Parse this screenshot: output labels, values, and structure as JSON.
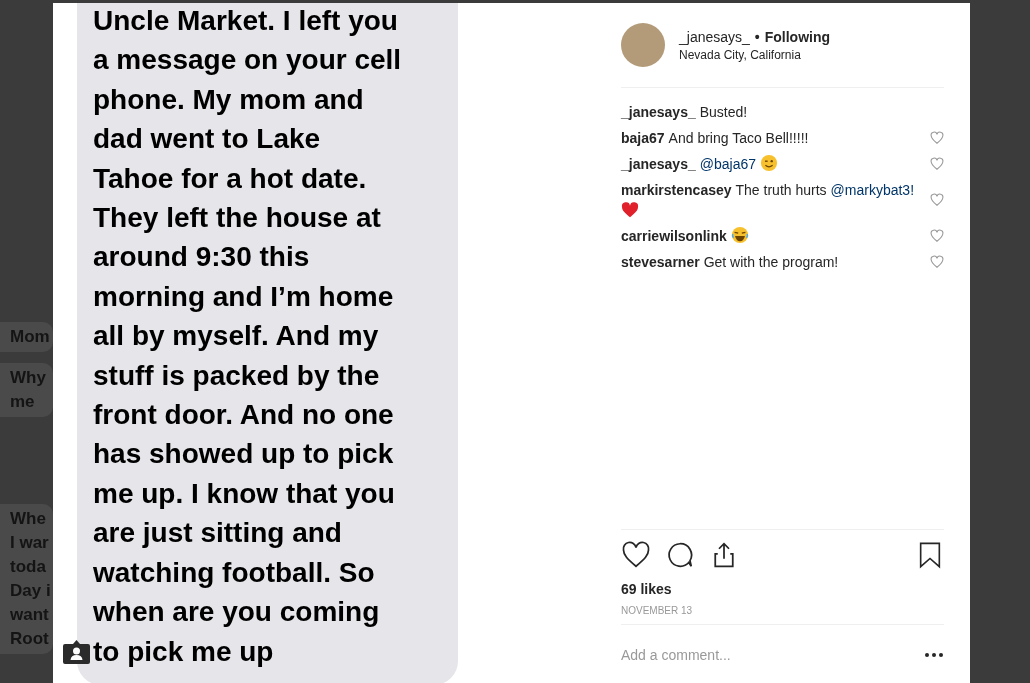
{
  "background_messages": [
    {
      "text": "Mom"
    },
    {
      "text": "Why\nme"
    },
    {
      "text": "Whe\nI war\ntoda\nDay i\nwant\nRoot"
    }
  ],
  "post": {
    "image_message": "Uncle Market. I left you\na message on your cell\nphone. My mom and\ndad went to Lake\nTahoe for a hot date.\nThey left the house at\naround 9:30 this\nmorning and I’m home\nall by myself. And my\nstuff is packed by the\nfront door. And no one\nhas showed up to pick\nme up. I know that you\nare just sitting and\nwatching football. So\nwhen are you coming\nto pick me up",
    "header": {
      "username": "_janesays_",
      "separator": "•",
      "follow": "Following",
      "location": "Nevada City, California"
    },
    "comments": [
      {
        "kind": "caption",
        "parts": [
          {
            "kind": "user",
            "text": "_janesays_"
          },
          {
            "kind": "text",
            "text": "Busted!"
          }
        ]
      },
      {
        "kind": "reply",
        "parts": [
          {
            "kind": "user",
            "text": "baja67"
          },
          {
            "kind": "text",
            "text": "And bring Taco Bell!!!!!"
          }
        ]
      },
      {
        "kind": "reply",
        "parts": [
          {
            "kind": "user",
            "text": "_janesays_"
          },
          {
            "kind": "mention",
            "text": "@baja67"
          },
          {
            "kind": "wink"
          }
        ]
      },
      {
        "kind": "reply",
        "parts": [
          {
            "kind": "user",
            "text": "markirstencasey"
          },
          {
            "kind": "text",
            "text": "The truth hurts"
          },
          {
            "kind": "mention",
            "text": "@markybat3!"
          },
          {
            "kind": "heart"
          }
        ]
      },
      {
        "kind": "reply",
        "parts": [
          {
            "kind": "user",
            "text": "carriewilsonlink"
          },
          {
            "kind": "laugh"
          }
        ]
      },
      {
        "kind": "reply",
        "parts": [
          {
            "kind": "user",
            "text": "stevesarner"
          },
          {
            "kind": "text",
            "text": "Get with the program!"
          }
        ]
      }
    ],
    "likes": "69 likes",
    "date": "NOVEMBER 13",
    "comment_field": {
      "placeholder": "Add a comment..."
    }
  }
}
